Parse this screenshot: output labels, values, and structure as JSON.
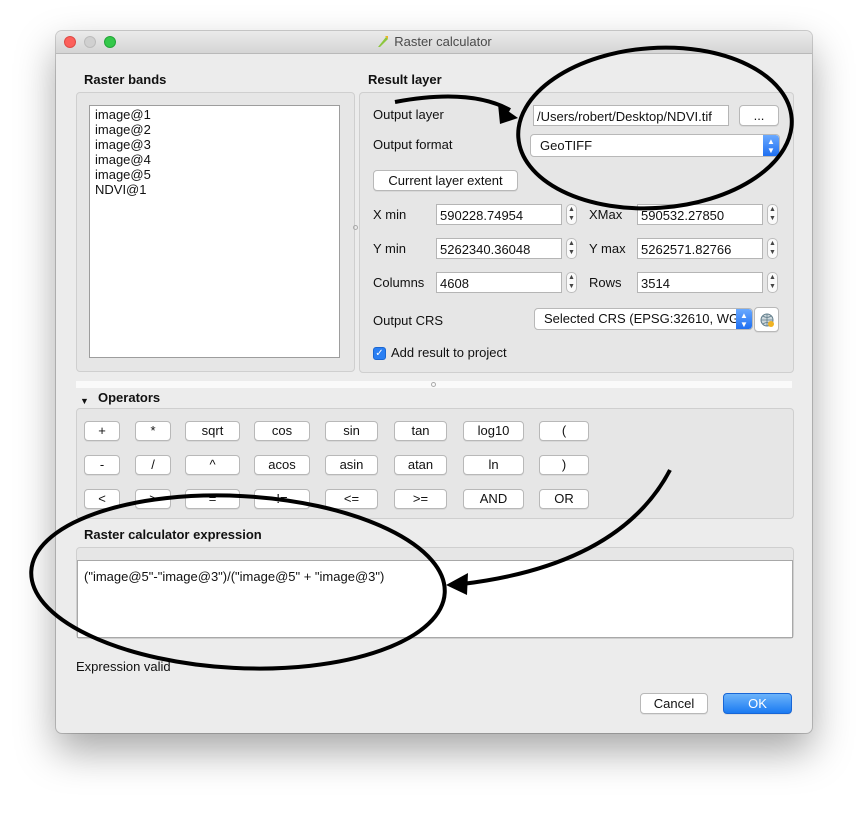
{
  "window": {
    "title": "Raster calculator"
  },
  "raster_bands": {
    "header": "Raster bands",
    "items": [
      "image@1",
      "image@2",
      "image@3",
      "image@4",
      "image@5",
      "NDVI@1"
    ]
  },
  "result_layer": {
    "header": "Result layer",
    "output_layer_label": "Output layer",
    "output_layer_value": "/Users/robert/Desktop/NDVI.tif",
    "browse_label": "...",
    "output_format_label": "Output format",
    "output_format_value": "GeoTIFF",
    "current_extent_label": "Current layer extent",
    "xmin_label": "X min",
    "xmin_value": "590228.74954",
    "xmax_label": "XMax",
    "xmax_value": "590532.27850",
    "ymin_label": "Y min",
    "ymin_value": "5262340.36048",
    "ymax_label": "Y max",
    "ymax_value": "5262571.82766",
    "columns_label": "Columns",
    "columns_value": "4608",
    "rows_label": "Rows",
    "rows_value": "3514",
    "crs_label": "Output CRS",
    "crs_value": "Selected CRS (EPSG:32610, WG",
    "add_result_label": "Add result to project",
    "add_result_checked": true
  },
  "operators": {
    "header": "Operators",
    "row1": [
      "+",
      "*",
      "sqrt",
      "cos",
      "sin",
      "tan",
      "log10",
      "("
    ],
    "row2": [
      "-",
      "/",
      "^",
      "acos",
      "asin",
      "atan",
      "ln",
      ")"
    ],
    "row3": [
      "<",
      ">",
      "=",
      "!=",
      "<=",
      ">=",
      "AND",
      "OR"
    ]
  },
  "expression": {
    "header": "Raster calculator expression",
    "value": "(\"image@5\"-\"image@3\")/(\"image@5\" + \"image@3\")",
    "status": "Expression valid"
  },
  "buttons": {
    "cancel": "Cancel",
    "ok": "OK"
  },
  "colors": {
    "accent": "#1b7af2",
    "window_bg": "#ececec",
    "annotation": "#000000"
  }
}
